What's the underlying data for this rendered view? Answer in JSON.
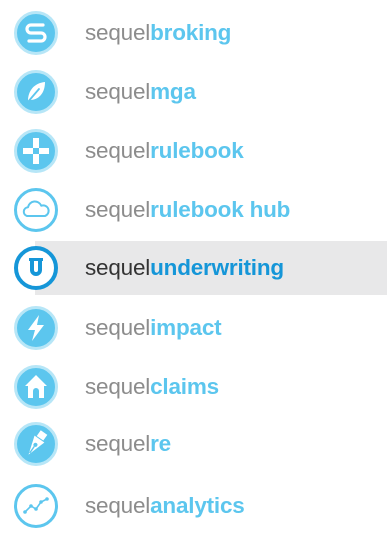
{
  "colors": {
    "icon_light": "#5cc6ee",
    "icon_ring": "#b7e6f7",
    "selected_blue": "#1596d8",
    "selected_bg": "#e8e8e9",
    "prefix_gray": "#8c8c8c"
  },
  "menu": {
    "selected_index": 4,
    "items": [
      {
        "prefix": "sequel",
        "suffix": "broking",
        "icon": "broking-s-icon"
      },
      {
        "prefix": "sequel",
        "suffix": "mga",
        "icon": "leaf-icon"
      },
      {
        "prefix": "sequel",
        "suffix": "rulebook",
        "icon": "puzzle-cross-icon"
      },
      {
        "prefix": "sequel",
        "suffix": "rulebook hub",
        "icon": "cloud-icon"
      },
      {
        "prefix": "sequel",
        "suffix": "underwriting",
        "icon": "underwriting-u-icon"
      },
      {
        "prefix": "sequel",
        "suffix": "impact",
        "icon": "lightning-icon"
      },
      {
        "prefix": "sequel",
        "suffix": "claims",
        "icon": "house-icon"
      },
      {
        "prefix": "sequel",
        "suffix": "re",
        "icon": "pen-nib-icon"
      },
      {
        "prefix": "sequel",
        "suffix": "analytics",
        "icon": "line-chart-icon"
      }
    ]
  }
}
